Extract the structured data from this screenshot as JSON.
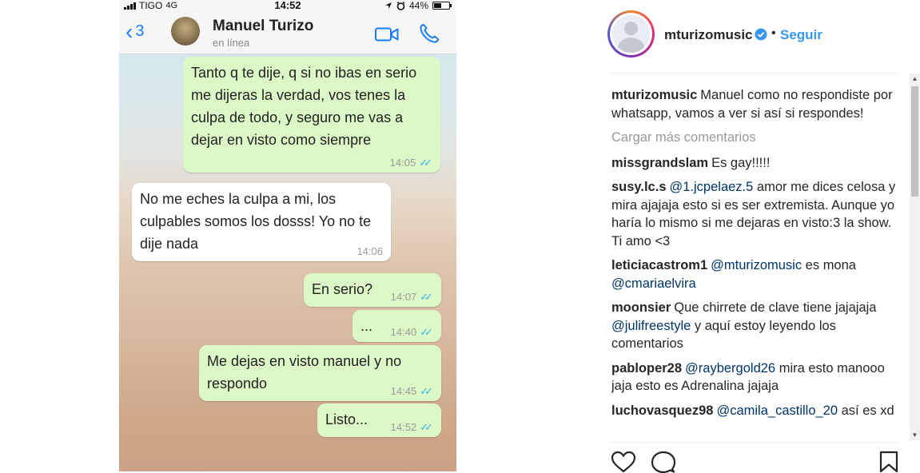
{
  "phone": {
    "carrier": "TIGO",
    "network": "4G",
    "time": "14:52",
    "battery": "44%",
    "back_count": "3",
    "contact_name": "Manuel Turizo",
    "contact_status": "en línea"
  },
  "messages": [
    {
      "text": "Tanto q te dije, q si no ibas en serio me dijeras la verdad, vos tenes la culpa de todo, y seguro me vas a dejar en visto como siempre",
      "time": "14:05",
      "direction": "out",
      "read": true
    },
    {
      "text": "No me eches la culpa a mi, los culpables somos los dosss! Yo no te dije nada",
      "time": "14:06",
      "direction": "in",
      "read": false
    },
    {
      "text": "En serio?",
      "time": "14:07",
      "direction": "out",
      "read": true
    },
    {
      "text": "...",
      "time": "14:40",
      "direction": "out",
      "read": true
    },
    {
      "text": "Me dejas en visto manuel y no respondo",
      "time": "14:45",
      "direction": "out",
      "read": true
    },
    {
      "text": "Listo...",
      "time": "14:52",
      "direction": "out",
      "read": true
    }
  ],
  "instagram": {
    "username": "mturizomusic",
    "separator": "•",
    "follow_label": "Seguir",
    "caption_user": "mturizomusic",
    "caption_text": "Manuel como no respondiste por whatsapp, vamos a ver si así si respondes!",
    "load_more": "Cargar más comentarios",
    "comments": [
      {
        "user": "missgrandslam",
        "parts": [
          {
            "t": "Es gay!!!!!",
            "m": false
          }
        ]
      },
      {
        "user": "susy.lc.s",
        "parts": [
          {
            "t": "@1.jcpelaez.5",
            "m": true
          },
          {
            "t": " amor me dices celosa y mira ajajaja esto si es ser extremista. Aunque yo haría lo mismo si me dejaras en visto:3 la show. Ti amo <3",
            "m": false
          }
        ]
      },
      {
        "user": "leticiacastrom1",
        "parts": [
          {
            "t": "@mturizomusic",
            "m": true
          },
          {
            "t": " es mona ",
            "m": false
          },
          {
            "t": "@cmariaelvira",
            "m": true
          }
        ]
      },
      {
        "user": "moonsier",
        "parts": [
          {
            "t": "Que chirrete de clave tiene jajajaja ",
            "m": false
          },
          {
            "t": "@julifreestyle",
            "m": true
          },
          {
            "t": " y aquí estoy leyendo los comentarios",
            "m": false
          }
        ]
      },
      {
        "user": "pabloper28",
        "parts": [
          {
            "t": "@raybergold26",
            "m": true
          },
          {
            "t": " mira esto manooo jaja esto es Adrenalina jajaja",
            "m": false
          }
        ]
      },
      {
        "user": "luchovasquez98",
        "parts": [
          {
            "t": "@camila_castillo_20",
            "m": true
          },
          {
            "t": " así es xd",
            "m": false
          }
        ]
      }
    ],
    "colors": {
      "accent": "#3897f0",
      "mention": "#003569",
      "muted": "#999999",
      "text": "#262626"
    }
  },
  "icons": [
    "signal-icon",
    "location-arrow-icon",
    "alarm-icon",
    "battery-icon",
    "back-chevron-icon",
    "video-call-icon",
    "phone-call-icon",
    "read-ticks-icon",
    "verified-badge-icon",
    "heart-icon",
    "comment-icon",
    "bookmark-icon"
  ]
}
